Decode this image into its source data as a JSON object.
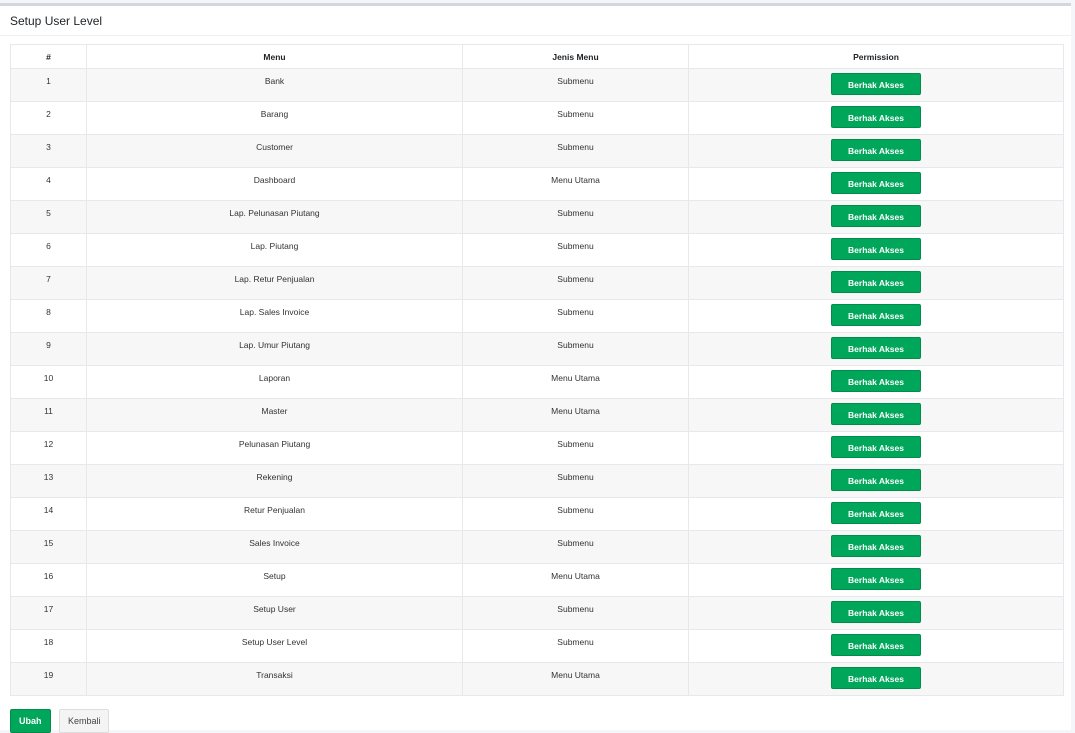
{
  "card": {
    "title": "Setup User Level"
  },
  "table": {
    "headers": {
      "num": "#",
      "menu": "Menu",
      "jenis": "Jenis Menu",
      "permission": "Permission"
    },
    "rows": [
      {
        "num": "1",
        "menu": "Bank",
        "jenis": "Submenu",
        "permission": "Berhak Akses"
      },
      {
        "num": "2",
        "menu": "Barang",
        "jenis": "Submenu",
        "permission": "Berhak Akses"
      },
      {
        "num": "3",
        "menu": "Customer",
        "jenis": "Submenu",
        "permission": "Berhak Akses"
      },
      {
        "num": "4",
        "menu": "Dashboard",
        "jenis": "Menu Utama",
        "permission": "Berhak Akses"
      },
      {
        "num": "5",
        "menu": "Lap. Pelunasan Piutang",
        "jenis": "Submenu",
        "permission": "Berhak Akses"
      },
      {
        "num": "6",
        "menu": "Lap. Piutang",
        "jenis": "Submenu",
        "permission": "Berhak Akses"
      },
      {
        "num": "7",
        "menu": "Lap. Retur Penjualan",
        "jenis": "Submenu",
        "permission": "Berhak Akses"
      },
      {
        "num": "8",
        "menu": "Lap. Sales Invoice",
        "jenis": "Submenu",
        "permission": "Berhak Akses"
      },
      {
        "num": "9",
        "menu": "Lap. Umur Piutang",
        "jenis": "Submenu",
        "permission": "Berhak Akses"
      },
      {
        "num": "10",
        "menu": "Laporan",
        "jenis": "Menu Utama",
        "permission": "Berhak Akses"
      },
      {
        "num": "11",
        "menu": "Master",
        "jenis": "Menu Utama",
        "permission": "Berhak Akses"
      },
      {
        "num": "12",
        "menu": "Pelunasan Piutang",
        "jenis": "Submenu",
        "permission": "Berhak Akses"
      },
      {
        "num": "13",
        "menu": "Rekening",
        "jenis": "Submenu",
        "permission": "Berhak Akses"
      },
      {
        "num": "14",
        "menu": "Retur Penjualan",
        "jenis": "Submenu",
        "permission": "Berhak Akses"
      },
      {
        "num": "15",
        "menu": "Sales Invoice",
        "jenis": "Submenu",
        "permission": "Berhak Akses"
      },
      {
        "num": "16",
        "menu": "Setup",
        "jenis": "Menu Utama",
        "permission": "Berhak Akses"
      },
      {
        "num": "17",
        "menu": "Setup User",
        "jenis": "Submenu",
        "permission": "Berhak Akses"
      },
      {
        "num": "18",
        "menu": "Setup User Level",
        "jenis": "Submenu",
        "permission": "Berhak Akses"
      },
      {
        "num": "19",
        "menu": "Transaksi",
        "jenis": "Menu Utama",
        "permission": "Berhak Akses"
      }
    ]
  },
  "actions": {
    "save_label": "Ubah",
    "back_label": "Kembali"
  },
  "colors": {
    "primary_green": "#00a65a",
    "border": "#e6e8eb",
    "stripe": "#f7f7f7"
  }
}
